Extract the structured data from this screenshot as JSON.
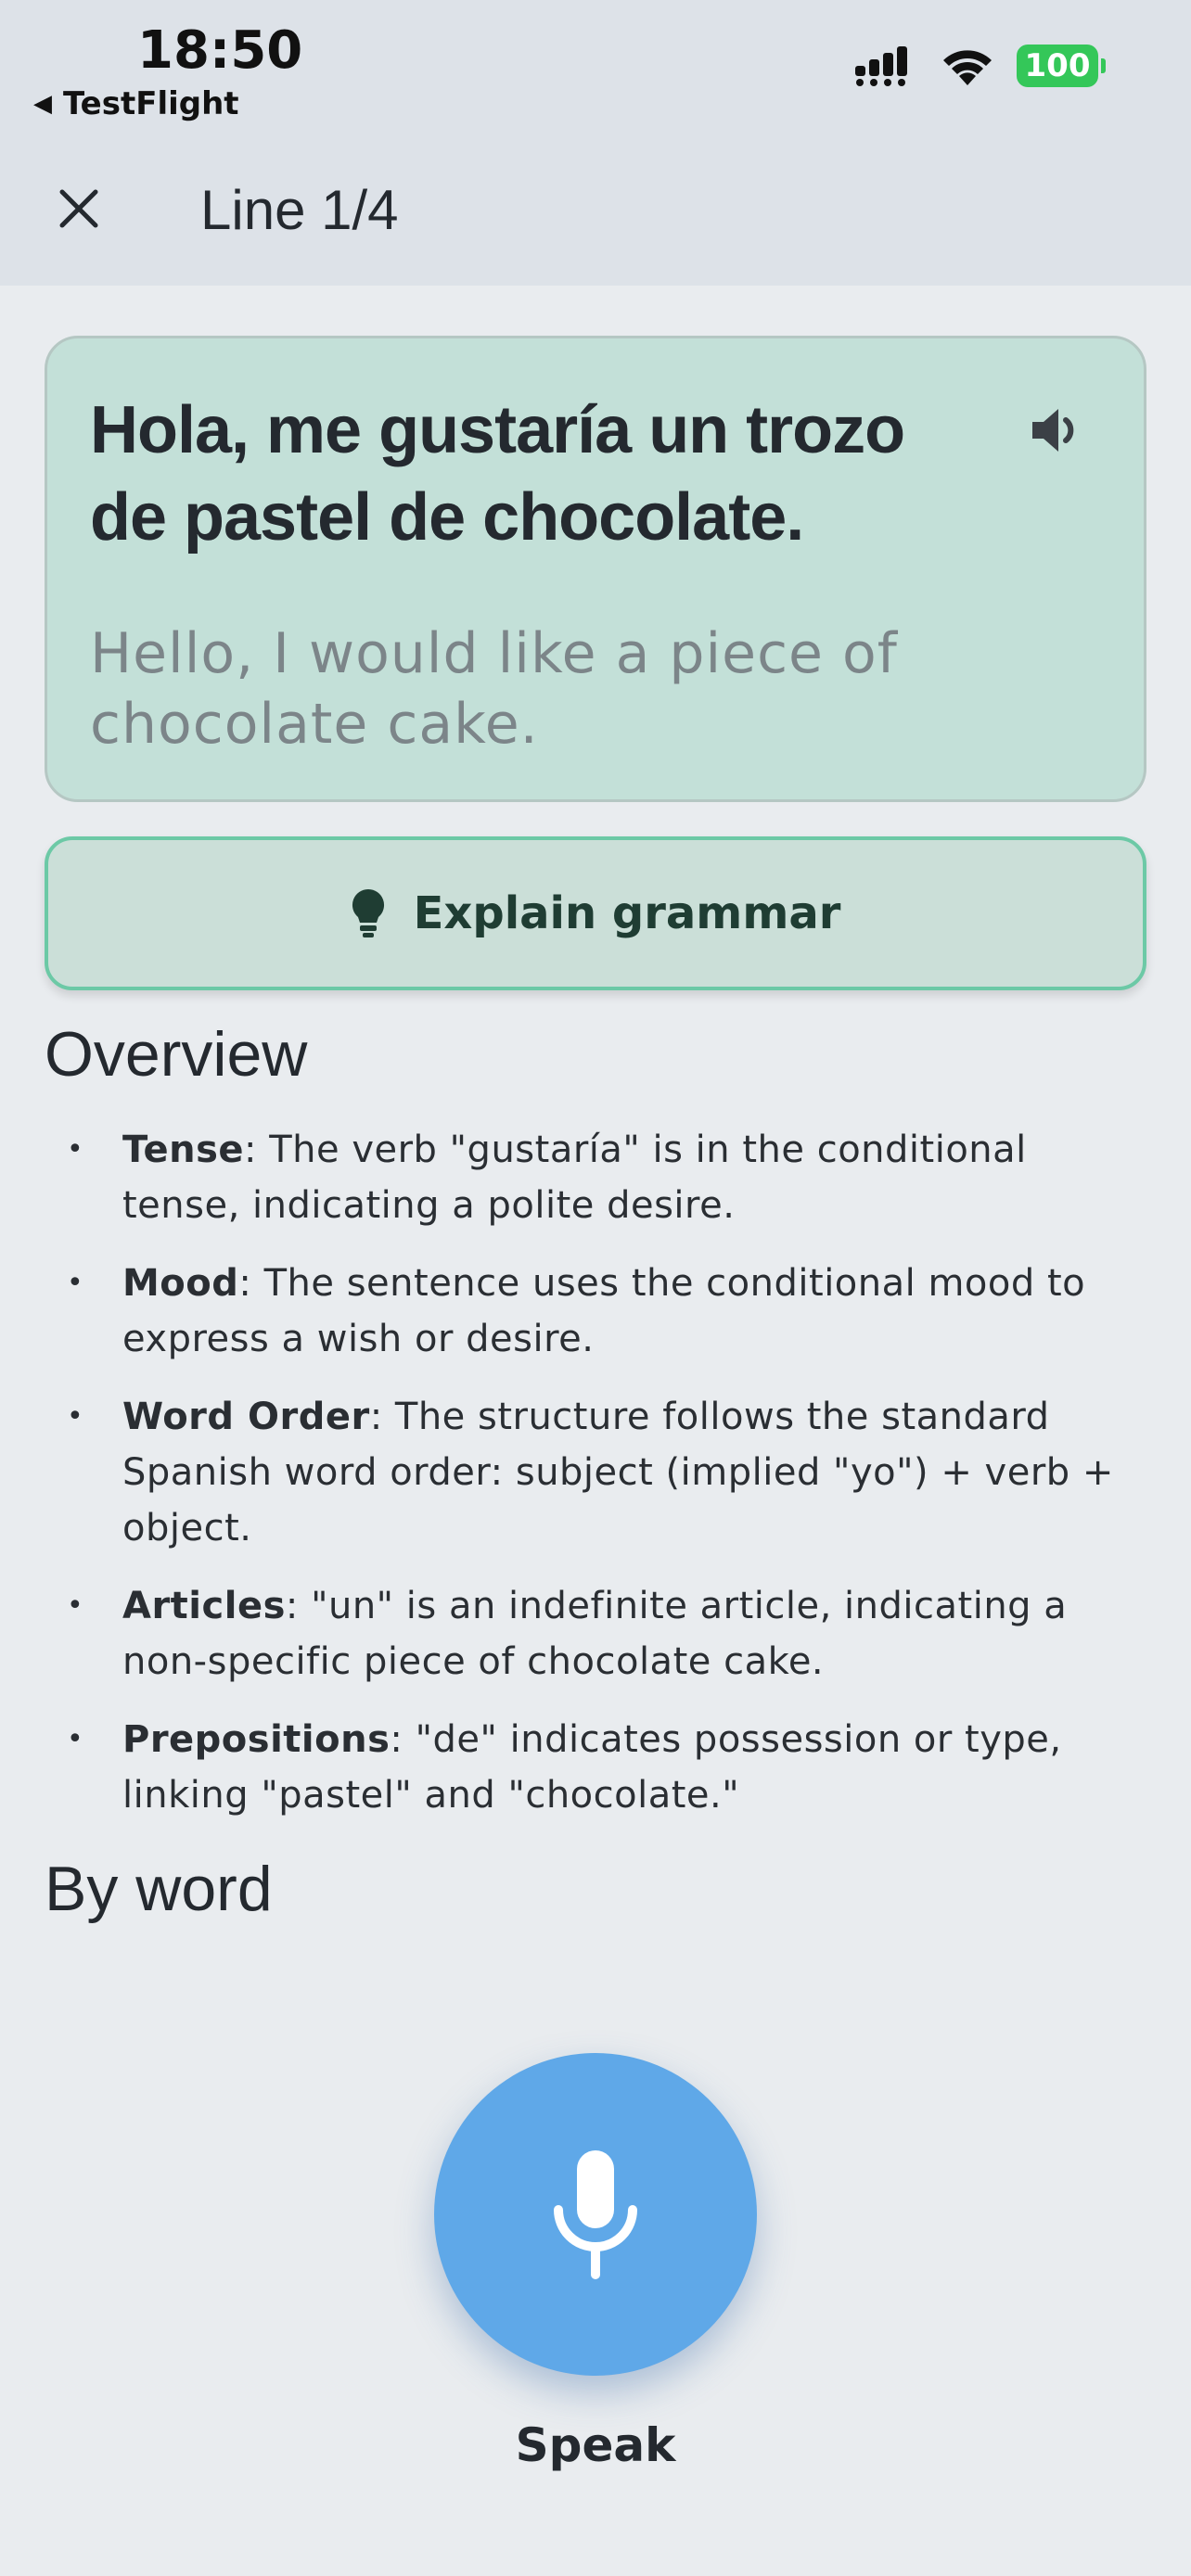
{
  "status_bar": {
    "time": "18:50",
    "back_app": "TestFlight",
    "battery": "100",
    "icons": [
      "cellular-signal-icon",
      "wifi-icon",
      "battery-icon"
    ]
  },
  "header": {
    "title": "Line 1/4"
  },
  "phrase": {
    "spanish": "Hola, me gustaría un trozo de pastel de chocolate.",
    "english": "Hello, I would like a piece of chocolate cake."
  },
  "explain_button": {
    "label": "Explain grammar"
  },
  "overview": {
    "title": "Overview",
    "items": [
      {
        "term": "Tense",
        "text": ": The verb \"gustaría\" is in the conditional tense, indicating a polite desire."
      },
      {
        "term": "Mood",
        "text": ": The sentence uses the conditional mood to express a wish or desire."
      },
      {
        "term": "Word Order",
        "text": ": The structure follows the standard Spanish word order: subject (implied \"yo\") + verb + object."
      },
      {
        "term": "Articles",
        "text": ": \"un\" is an indefinite article, indicating a non-specific piece of chocolate cake."
      },
      {
        "term": "Prepositions",
        "text": ": \"de\" indicates possession or type, linking \"pastel\" and \"chocolate.\""
      }
    ]
  },
  "by_word": {
    "title": "By word"
  },
  "speak": {
    "label": "Speak"
  },
  "colors": {
    "card_bg": "#c3e0d8",
    "button_border": "#6cc9a6",
    "mic_bg": "#5fa8e8",
    "battery": "#34c759"
  }
}
